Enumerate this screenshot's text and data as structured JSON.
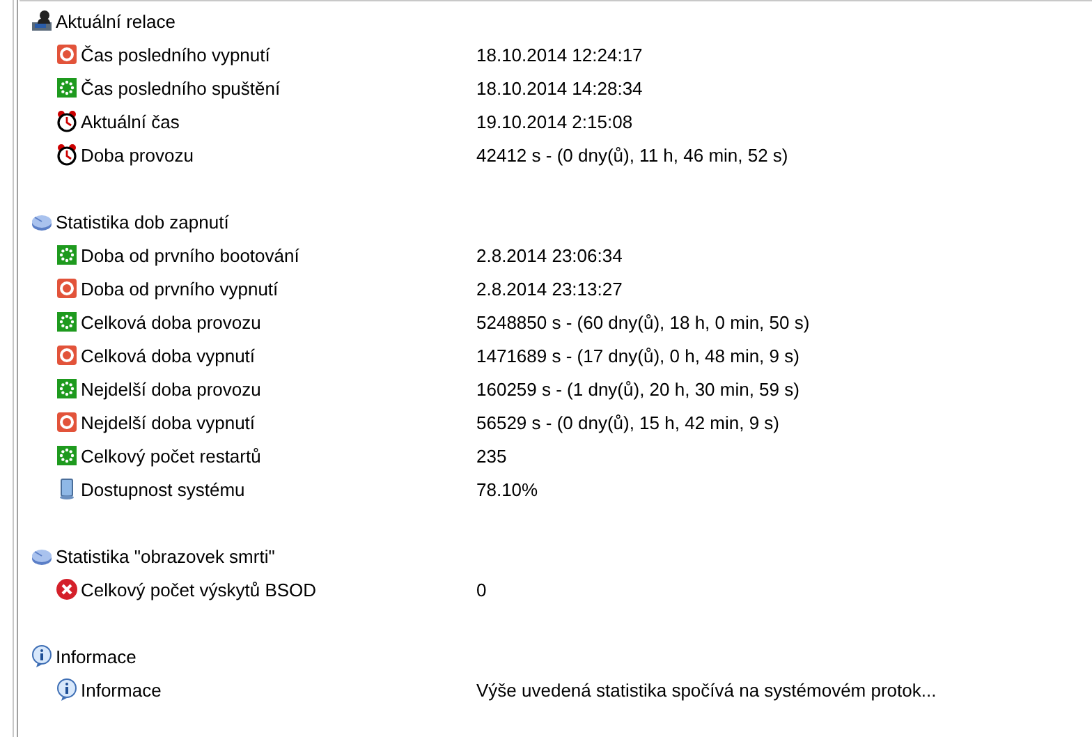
{
  "sections": [
    {
      "title": "Aktuální relace",
      "kind": "session",
      "items": [
        {
          "label": "Čas posledního vypnutí",
          "kind": "off",
          "value": "18.10.2014 12:24:17"
        },
        {
          "label": "Čas posledního spuštění",
          "kind": "on",
          "value": "18.10.2014 14:28:34"
        },
        {
          "label": "Aktuální čas",
          "kind": "clock",
          "value": "19.10.2014 2:15:08"
        },
        {
          "label": "Doba provozu",
          "kind": "clock",
          "value": "42412 s - (0 dny(ů), 11 h, 46 min, 52 s)"
        }
      ]
    },
    {
      "title": "Statistika dob zapnutí",
      "kind": "pie",
      "items": [
        {
          "label": "Doba od prvního bootování",
          "kind": "on",
          "value": "2.8.2014 23:06:34"
        },
        {
          "label": "Doba od prvního vypnutí",
          "kind": "off",
          "value": "2.8.2014 23:13:27"
        },
        {
          "label": "Celková doba provozu",
          "kind": "on",
          "value": "5248850 s - (60 dny(ů), 18 h, 0 min, 50 s)"
        },
        {
          "label": "Celková doba vypnutí",
          "kind": "off",
          "value": "1471689 s - (17 dny(ů), 0 h, 48 min, 9 s)"
        },
        {
          "label": "Nejdelší doba provozu",
          "kind": "on",
          "value": "160259 s - (1 dny(ů), 20 h, 30 min, 59 s)"
        },
        {
          "label": "Nejdelší doba vypnutí",
          "kind": "off",
          "value": "56529 s - (0 dny(ů), 15 h, 42 min, 9 s)"
        },
        {
          "label": "Celkový počet restartů",
          "kind": "on",
          "value": "235"
        },
        {
          "label": "Dostupnost systému",
          "kind": "computer",
          "value": "78.10%"
        }
      ]
    },
    {
      "title": "Statistika \"obrazovek smrti\"",
      "kind": "pie",
      "items": [
        {
          "label": "Celkový počet výskytů BSOD",
          "kind": "error",
          "value": "0"
        }
      ]
    },
    {
      "title": "Informace",
      "kind": "info",
      "items": [
        {
          "label": "Informace",
          "kind": "info",
          "value": "Výše uvedená statistika spočívá na systémovém protok..."
        }
      ]
    }
  ]
}
